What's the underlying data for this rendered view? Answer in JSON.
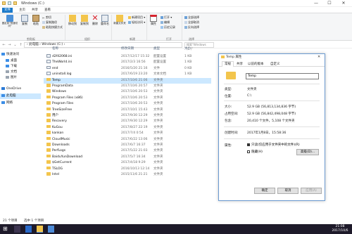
{
  "window": {
    "title": "Windows (C:)",
    "minimize": "—",
    "maximize": "☐",
    "close": "✕"
  },
  "ribbon_tabs": [
    "文件",
    "主页",
    "共享",
    "查看"
  ],
  "ribbon": {
    "pin_label": "固定到\"快速访问\"",
    "copy_label": "复制",
    "paste_label": "粘贴",
    "cut": "剪切",
    "copy_path": "复制路径",
    "paste_shortcut": "粘贴快捷方式",
    "move_to": "移动到",
    "copy_to": "复制到",
    "delete": "删除",
    "rename": "重命名",
    "new_folder": "新建文件夹",
    "new_item": "新建项目 ▾",
    "easy_access": "轻松访问 ▾",
    "properties": "属性",
    "open": "打开 ▾",
    "edit": "编辑",
    "history": "历史记录",
    "select_all": "全部选择",
    "select_none": "全部取消",
    "invert_select": "反向选择",
    "groups": {
      "clipboard": "剪贴板",
      "organize": "组织",
      "new": "新建",
      "open": "打开",
      "select": "选择"
    }
  },
  "address": {
    "path": "›  此电脑  ›  Windows (C:)  ›",
    "search_placeholder": "搜索\"Windows (C:)\""
  },
  "nav": [
    {
      "label": "快速访问",
      "icon": "star-icon",
      "color": "#3c8ee6"
    },
    {
      "label": "桌面",
      "icon": "desktop-icon",
      "color": "#3c8ee6"
    },
    {
      "label": "下载",
      "icon": "download-icon",
      "color": "#3c8ee6"
    },
    {
      "label": "文档",
      "icon": "document-icon",
      "color": "#9aa4b0"
    },
    {
      "label": "图片",
      "icon": "picture-icon",
      "color": "#9aa4b0"
    },
    {
      "label": "OneDrive",
      "icon": "cloud-icon",
      "color": "#2a7ad5"
    },
    {
      "label": "此电脑",
      "icon": "computer-icon",
      "color": "#3c8ee6"
    },
    {
      "label": "网络",
      "icon": "network-icon",
      "color": "#3c8ee6"
    }
  ],
  "columns": {
    "name": "名称",
    "date": "修改日期",
    "type": "类型",
    "size": "大小"
  },
  "files": [
    {
      "name": "d2f42068.ini",
      "date": "2017/12/17 15:32",
      "type": "配置设置",
      "size": "1 KB",
      "folder": false
    },
    {
      "name": "TheWorld.ini",
      "date": "2017/2/3 16:56",
      "type": "配置设置",
      "size": "1 KB",
      "folder": false
    },
    {
      "name": "end",
      "date": "2016/5/20 21:16",
      "type": "文件",
      "size": "0 KB",
      "folder": false
    },
    {
      "name": "uninstall.log",
      "date": "2017/6/19 23:20",
      "type": "文本文档",
      "size": "1 KB",
      "folder": false
    },
    {
      "name": "Temp",
      "date": "2017/10/6 21:06",
      "type": "文件夹",
      "size": "",
      "folder": true,
      "selected": true
    },
    {
      "name": "ProgramData",
      "date": "2017/10/6 20:57",
      "type": "文件夹",
      "size": "",
      "folder": true
    },
    {
      "name": "Windows",
      "date": "2017/10/6 20:53",
      "type": "文件夹",
      "size": "",
      "folder": true
    },
    {
      "name": "Program Files (x86)",
      "date": "2017/10/6 20:53",
      "type": "文件夹",
      "size": "",
      "folder": true
    },
    {
      "name": "Program Files",
      "date": "2017/10/6 20:53",
      "type": "文件夹",
      "size": "",
      "folder": true
    },
    {
      "name": "TreeSizeFree",
      "date": "2017/10/1 15:43",
      "type": "文件夹",
      "size": "",
      "folder": true
    },
    {
      "name": "用户",
      "date": "2017/9/30 12:29",
      "type": "文件夹",
      "size": "",
      "folder": true
    },
    {
      "name": "Recovery",
      "date": "2017/9/30 12:29",
      "type": "文件夹",
      "size": "",
      "folder": true
    },
    {
      "name": "KuGou",
      "date": "2017/8/27 22:19",
      "type": "文件夹",
      "size": "",
      "folder": true
    },
    {
      "name": "kankan",
      "date": "2017/7/4 0:54",
      "type": "文件夹",
      "size": "",
      "folder": true
    },
    {
      "name": "CloudMusic",
      "date": "2017/6/22 13:06",
      "type": "文件夹",
      "size": "",
      "folder": true
    },
    {
      "name": "Downloads",
      "date": "2017/6/7 16:37",
      "type": "文件夹",
      "size": "",
      "folder": true
    },
    {
      "name": "PerfLogs",
      "date": "2017/5/22 21:03",
      "type": "文件夹",
      "size": "",
      "folder": true
    },
    {
      "name": "BaiduYunDownload",
      "date": "2017/5/7 16:34",
      "type": "文件夹",
      "size": "",
      "folder": true
    },
    {
      "name": "$GetCurrent",
      "date": "2017/4/18 9:29",
      "type": "文件夹",
      "size": "",
      "folder": true
    },
    {
      "name": "TSLOG",
      "date": "2016/10/13 12:14",
      "type": "文件夹",
      "size": "",
      "folder": true
    },
    {
      "name": "Intel",
      "date": "2015/11/6 21:21",
      "type": "文件夹",
      "size": "",
      "folder": true
    }
  ],
  "status": {
    "count": "21 个项目",
    "selected": "选中 1 个项目"
  },
  "dialog": {
    "title": "Temp 属性",
    "tabs": [
      "常规",
      "共享",
      "以前的版本",
      "自定义"
    ],
    "name": "Temp",
    "type_label": "类型:",
    "type_value": "文件夹",
    "location_label": "位置:",
    "location_value": "C:\\",
    "size_label": "大小:",
    "size_value": "52.9 GB (56,813,134,836 字节)",
    "disk_label": "占用空间:",
    "disk_value": "52.9 GB (56,842,498,048 字节)",
    "contains_label": "包含:",
    "contains_value": "20,410 个文件，5,108 个文件夹",
    "created_label": "创建时间:",
    "created_value": "2017年1月8日，15:58:36",
    "attr_label": "属性:",
    "readonly_label": "只读(仅应用于文件夹中的文件)(R)",
    "hidden_label": "隐藏(H)",
    "advanced_label": "高级(D)...",
    "ok": "确定",
    "cancel": "取消",
    "apply": "应用(A)"
  },
  "clock": {
    "time": "21:08",
    "date": "2017/10/6"
  },
  "colors": {
    "accent": "#1979ca",
    "folder": "#f3c54c",
    "selection": "#cce8ff",
    "taskbar": "#1e1a2a"
  }
}
